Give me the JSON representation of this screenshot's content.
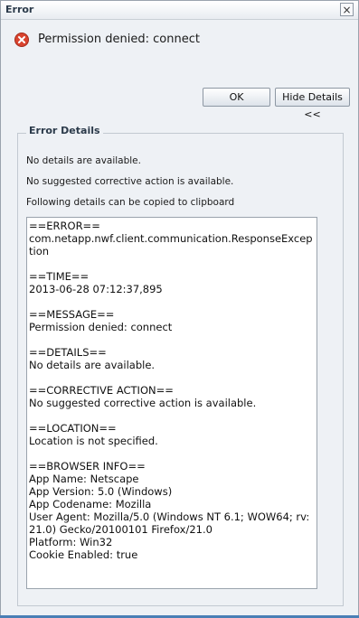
{
  "dialog": {
    "title": "Error",
    "close_icon": "close-icon",
    "message": "Permission denied: connect",
    "message_icon": "error-icon"
  },
  "buttons": {
    "ok": "OK",
    "hide_details": "Hide Details <<"
  },
  "details": {
    "legend": "Error Details",
    "info_lines": [
      "No details are available.",
      "No suggested corrective action is available.",
      "Following details can be copied to clipboard"
    ],
    "text": "==ERROR==\ncom.netapp.nwf.client.communication.ResponseException\n\n==TIME==\n2013-06-28 07:12:37,895\n\n==MESSAGE==\nPermission denied: connect\n\n==DETAILS==\nNo details are available.\n\n==CORRECTIVE ACTION==\nNo suggested corrective action is available.\n\n==LOCATION==\nLocation is not specified.\n\n==BROWSER INFO==\nApp Name: Netscape\nApp Version: 5.0 (Windows)\nApp Codename: Mozilla\nUser Agent: Mozilla/5.0 (Windows NT 6.1; WOW64; rv:21.0) Gecko/20100101 Firefox/21.0\nPlatform: Win32\nCookie Enabled: true"
  },
  "colors": {
    "accent": "#4a7fb5",
    "error_red": "#d9442f"
  }
}
